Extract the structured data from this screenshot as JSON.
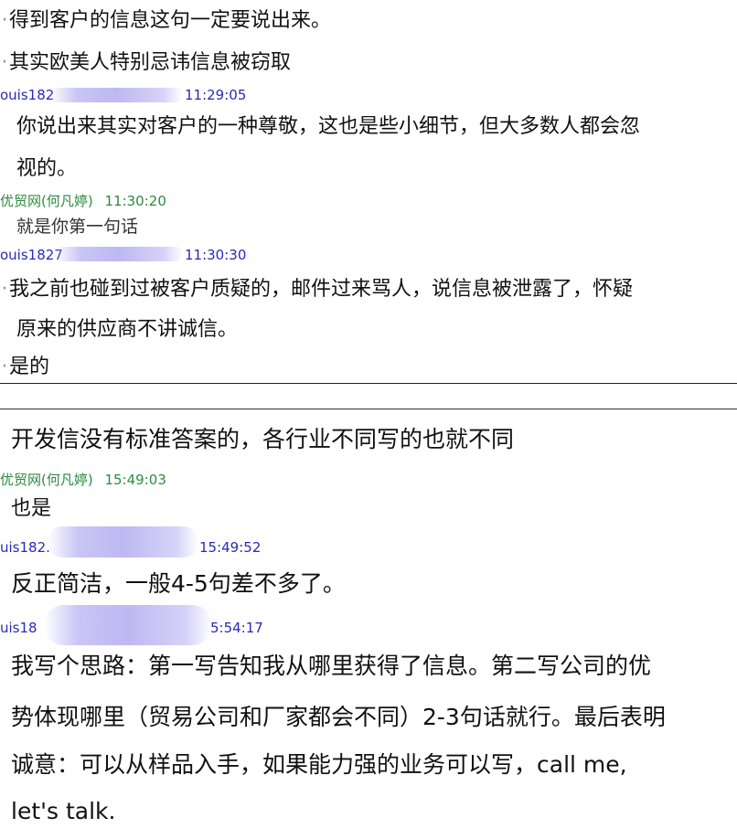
{
  "top": {
    "line1": "得到客户的信息这句一定要说出来。",
    "line2": "其实欧美人特别忌讳信息被窃取",
    "meta1": {
      "name": "ouis182",
      "time": "11:29:05"
    },
    "msg1a": "你说出来其实对客户的一种尊敬，这也是些小细节，但大多数人都会忽",
    "msg1b": "视的。",
    "meta2": {
      "name": "优贸网(何凡婷)",
      "time": "11:30:20"
    },
    "msg2": "就是你第一句话",
    "meta3": {
      "name": "ouis1827",
      "time": "11:30:30"
    },
    "msg3a": "我之前也碰到过被客户质疑的，邮件过来骂人，说信息被泄露了，怀疑",
    "msg3b": "原来的供应商不讲诚信。",
    "msg4": "是的"
  },
  "bottom": {
    "line0": "开发信没有标准答案的，各行业不同写的也就不同",
    "meta1": {
      "name": "优贸网(何凡婷)",
      "time": "15:49:03"
    },
    "msg1": "也是",
    "meta2": {
      "name": "uis182.",
      "time": "15:49:52"
    },
    "msg2": "反正简洁，一般4-5句差不多了。",
    "meta3": {
      "name": "uis18",
      "time": "5:54:17"
    },
    "msg3a": "我写个思路：第一写告知我从哪里获得了信息。第二写公司的优",
    "msg3b": "势体现哪里（贸易公司和厂家都会不同）2-3句话就行。最后表明",
    "msg3c": "诚意：可以从样品入手，如果能力强的业务可以写，call me,",
    "msg3d": "let's talk."
  }
}
